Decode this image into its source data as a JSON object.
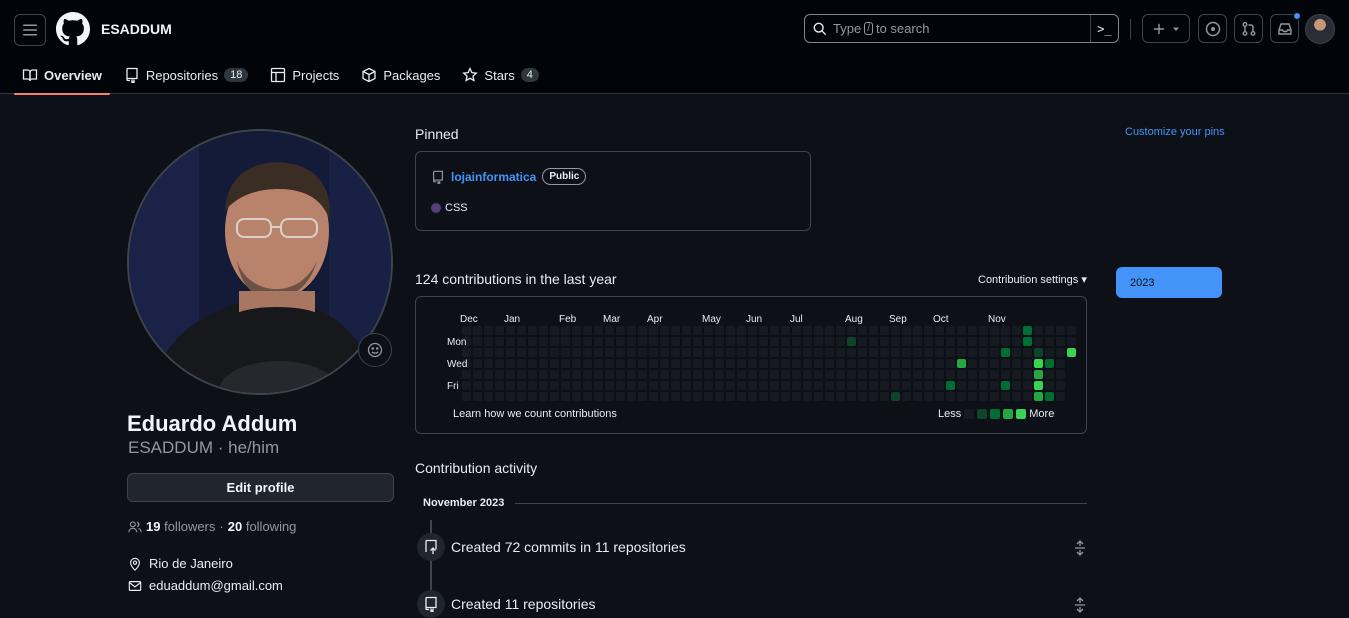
{
  "header": {
    "user": "ESADDUM",
    "search_prefix": "Type",
    "search_key": "/",
    "search_suffix": "to search",
    "command_glyph": ">_"
  },
  "tabs": [
    {
      "label": "Overview",
      "icon": "book-icon"
    },
    {
      "label": "Repositories",
      "count": "18",
      "icon": "repo-icon"
    },
    {
      "label": "Projects",
      "icon": "table-icon"
    },
    {
      "label": "Packages",
      "icon": "package-icon"
    },
    {
      "label": "Stars",
      "count": "4",
      "icon": "star-icon"
    }
  ],
  "profile": {
    "full_name": "Eduardo Addum",
    "login_line": "ESADDUM · he/him",
    "edit_label": "Edit profile",
    "followers_count": "19",
    "followers_label": "followers",
    "sep": "·",
    "following_count": "20",
    "following_label": "following",
    "location": "Rio de Janeiro",
    "email": "eduaddum@gmail.com"
  },
  "pinned": {
    "title": "Pinned",
    "customize": "Customize your pins",
    "repo": "lojainformatica",
    "visibility": "Public",
    "language": "CSS",
    "language_color": "#563d7c"
  },
  "contributions": {
    "title": "124 contributions in the last year",
    "settings": "Contribution settings ▾",
    "year": "2023",
    "months": [
      "Dec",
      "Jan",
      "Feb",
      "Mar",
      "Apr",
      "May",
      "Jun",
      "Jul",
      "Aug",
      "Sep",
      "Oct",
      "Nov"
    ],
    "days": [
      "Mon",
      "Wed",
      "Fri"
    ],
    "learn": "Learn how we count contributions",
    "less": "Less",
    "more": "More",
    "levels": [
      "#161b22",
      "#0e4429",
      "#006d32",
      "#26a641",
      "#39d353"
    ],
    "active_cells": [
      {
        "week": 35,
        "day": 1,
        "level": 1
      },
      {
        "week": 39,
        "day": 6,
        "level": 1
      },
      {
        "week": 44,
        "day": 5,
        "level": 2
      },
      {
        "week": 45,
        "day": 3,
        "level": 3
      },
      {
        "week": 49,
        "day": 2,
        "level": 2
      },
      {
        "week": 49,
        "day": 5,
        "level": 2
      },
      {
        "week": 51,
        "day": 0,
        "level": 2
      },
      {
        "week": 51,
        "day": 1,
        "level": 2
      },
      {
        "week": 52,
        "day": 2,
        "level": 1
      },
      {
        "week": 52,
        "day": 3,
        "level": 4
      },
      {
        "week": 52,
        "day": 4,
        "level": 3
      },
      {
        "week": 52,
        "day": 5,
        "level": 4
      },
      {
        "week": 52,
        "day": 6,
        "level": 3
      },
      {
        "week": 53,
        "day": 3,
        "level": 2
      },
      {
        "week": 53,
        "day": 6,
        "level": 2
      },
      {
        "week": 55,
        "day": 2,
        "level": 4
      }
    ]
  },
  "activity": {
    "title": "Contribution activity",
    "month": "November 2023",
    "items": [
      {
        "text": "Created 72 commits in 11 repositories"
      },
      {
        "text": "Created 11 repositories"
      }
    ]
  }
}
